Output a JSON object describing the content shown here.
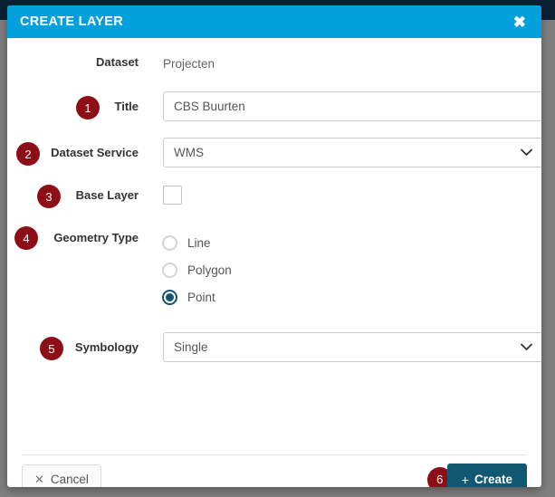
{
  "modal": {
    "title": "CREATE LAYER",
    "close_icon": "close-icon"
  },
  "form": {
    "dataset": {
      "label": "Dataset",
      "value": "Projecten"
    },
    "title_field": {
      "badge": "1",
      "label": "Title",
      "value": "CBS Buurten",
      "placeholder": ""
    },
    "dataset_service": {
      "badge": "2",
      "label": "Dataset Service",
      "value": "WMS",
      "icon": "chevron-down-icon"
    },
    "base_layer": {
      "badge": "3",
      "label": "Base Layer",
      "checked": false
    },
    "geometry_type": {
      "badge": "4",
      "label": "Geometry Type",
      "options": [
        {
          "label": "Line",
          "selected": false
        },
        {
          "label": "Polygon",
          "selected": false
        },
        {
          "label": "Point",
          "selected": true
        }
      ]
    },
    "symbology": {
      "badge": "5",
      "label": "Symbology",
      "value": "Single",
      "icon": "chevron-down-icon"
    }
  },
  "footer": {
    "cancel_label": "Cancel",
    "cancel_icon": "✕",
    "create_label": "Create",
    "create_icon": "+",
    "create_badge": "6"
  },
  "colors": {
    "header": "#00a0dd",
    "badge": "#8d0e16",
    "create_button": "#125872",
    "radio_selected": "#135571",
    "backdrop": "#7f7f7f",
    "app_bar": "#0b2133"
  }
}
